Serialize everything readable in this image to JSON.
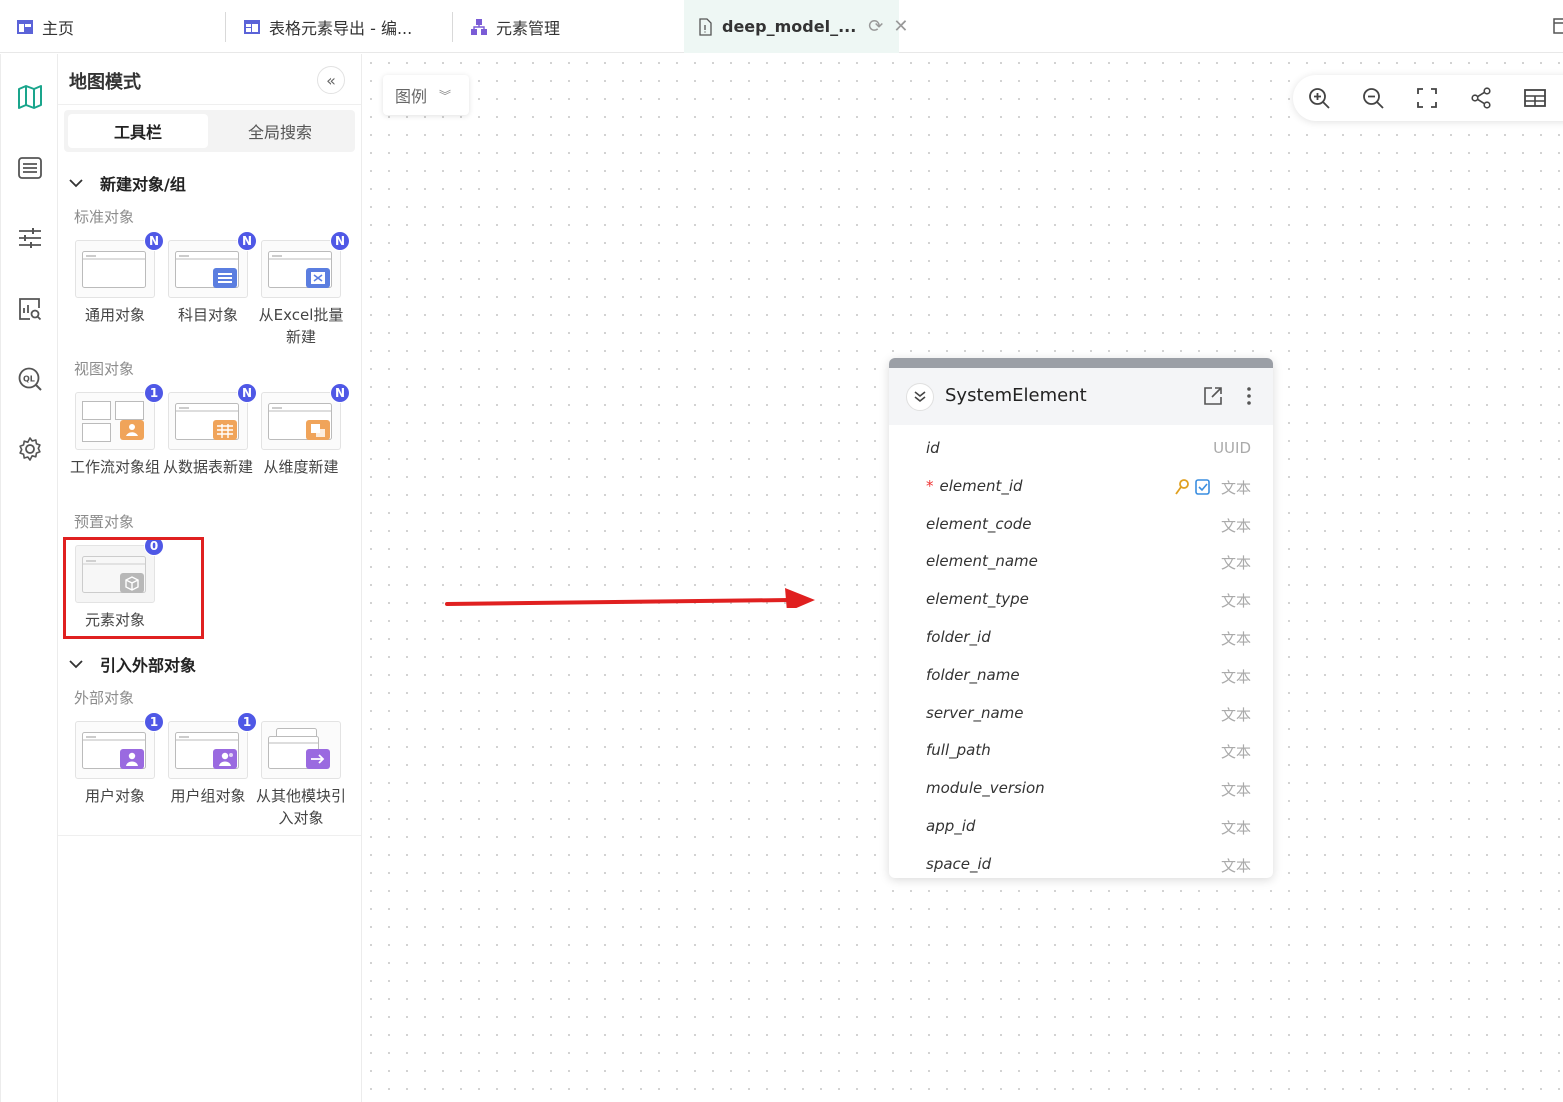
{
  "tabs": [
    {
      "label": "主页",
      "icon": "dashboard-icon"
    },
    {
      "label": "表格元素导出 - 编...",
      "icon": "table-icon"
    },
    {
      "label": "元素管理",
      "icon": "hierarchy-icon"
    },
    {
      "label": "deep_model_...",
      "icon": "document-icon"
    }
  ],
  "panel": {
    "title": "地图模式",
    "segments": [
      "工具栏",
      "全局搜索"
    ],
    "sections": [
      {
        "title": "新建对象/组",
        "groups": [
          {
            "label": "标准对象",
            "tiles": [
              {
                "caption": "通用对象",
                "badge": "N"
              },
              {
                "caption": "科目对象",
                "badge": "N"
              },
              {
                "caption": "从Excel批量新建",
                "badge": "N"
              }
            ]
          },
          {
            "label": "视图对象",
            "tiles": [
              {
                "caption": "工作流对象组",
                "badge": "1"
              },
              {
                "caption": "从数据表新建",
                "badge": "N"
              },
              {
                "caption": "从维度新建",
                "badge": "N"
              }
            ]
          },
          {
            "label": "预置对象",
            "tiles": [
              {
                "caption": "元素对象",
                "badge": "0"
              }
            ]
          }
        ]
      },
      {
        "title": "引入外部对象",
        "groups": [
          {
            "label": "外部对象",
            "tiles": [
              {
                "caption": "用户对象",
                "badge": "1"
              },
              {
                "caption": "用户组对象",
                "badge": "1"
              },
              {
                "caption": "从其他模块引入对象",
                "badge": null
              }
            ]
          }
        ]
      }
    ]
  },
  "canvas": {
    "legend_label": "图例"
  },
  "entity": {
    "name": "SystemElement",
    "fields": [
      {
        "name": "id",
        "type": "UUID",
        "required": false
      },
      {
        "name": "element_id",
        "type": "文本",
        "required": true
      },
      {
        "name": "element_code",
        "type": "文本",
        "required": false
      },
      {
        "name": "element_name",
        "type": "文本",
        "required": false
      },
      {
        "name": "element_type",
        "type": "文本",
        "required": false
      },
      {
        "name": "folder_id",
        "type": "文本",
        "required": false
      },
      {
        "name": "folder_name",
        "type": "文本",
        "required": false
      },
      {
        "name": "server_name",
        "type": "文本",
        "required": false
      },
      {
        "name": "full_path",
        "type": "文本",
        "required": false
      },
      {
        "name": "module_version",
        "type": "文本",
        "required": false
      },
      {
        "name": "app_id",
        "type": "文本",
        "required": false
      },
      {
        "name": "space_id",
        "type": "文本",
        "required": false
      }
    ]
  },
  "colors": {
    "accent": "#4f58e6",
    "highlight": "#e02020",
    "card_bar": "#9b9fa6"
  }
}
